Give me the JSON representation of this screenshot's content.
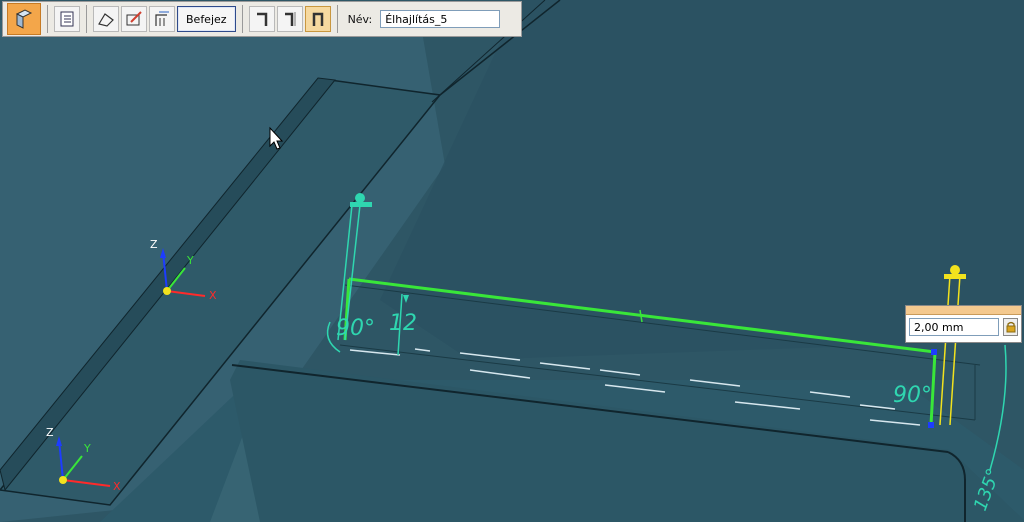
{
  "toolbar": {
    "finish_button": "Befejez",
    "name_label": "Név:",
    "name_value": "Élhajlítás_5"
  },
  "viewport": {
    "dimension_90_left": "90°",
    "dimension_12": "12",
    "dimension_90_right": "90°",
    "dimension_135": "135°",
    "axis_z": "Z",
    "axis_y": "Y",
    "axis_x": "X"
  },
  "dimension_box": {
    "value": "2,00 mm"
  },
  "colors": {
    "background": "#2f5866",
    "sketch_green": "#39e639",
    "dimension_teal": "#2fd6b0",
    "handle_yellow": "#f2e21e"
  }
}
